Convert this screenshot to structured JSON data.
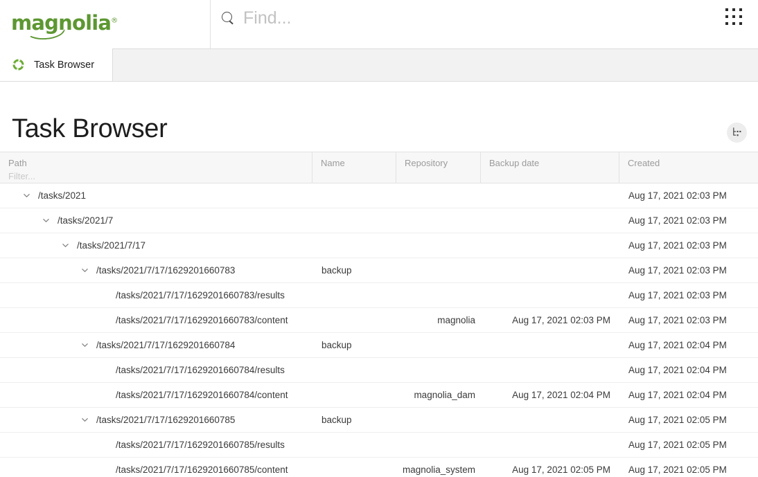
{
  "brand": {
    "logo_text": "magnolia",
    "logo_mark": "®",
    "logo_color": "#5d9732"
  },
  "header": {
    "search_placeholder": "Find...",
    "search_value": "",
    "search_icon": "search-icon",
    "launcher_icon": "apps-grid-icon"
  },
  "tabs": [
    {
      "label": "Task Browser",
      "icon": "recycle-icon",
      "active": true
    }
  ],
  "page": {
    "title": "Task Browser",
    "tree_toggle_icon": "tree-hierarchy-icon"
  },
  "table": {
    "columns": [
      {
        "key": "path",
        "label": "Path",
        "filter_placeholder": "Filter...",
        "has_filter": true
      },
      {
        "key": "name",
        "label": "Name",
        "has_filter": false
      },
      {
        "key": "repository",
        "label": "Repository",
        "has_filter": false
      },
      {
        "key": "backup_date",
        "label": "Backup date",
        "has_filter": false
      },
      {
        "key": "created",
        "label": "Created",
        "has_filter": false
      }
    ],
    "rows": [
      {
        "level": 0,
        "expandable": true,
        "expanded": true,
        "path": "/tasks/2021",
        "name": "",
        "repository": "",
        "backup_date": "",
        "created": "Aug 17, 2021 02:03 PM"
      },
      {
        "level": 1,
        "expandable": true,
        "expanded": true,
        "path": "/tasks/2021/7",
        "name": "",
        "repository": "",
        "backup_date": "",
        "created": "Aug 17, 2021 02:03 PM"
      },
      {
        "level": 2,
        "expandable": true,
        "expanded": true,
        "path": "/tasks/2021/7/17",
        "name": "",
        "repository": "",
        "backup_date": "",
        "created": "Aug 17, 2021 02:03 PM"
      },
      {
        "level": 3,
        "expandable": true,
        "expanded": true,
        "path": "/tasks/2021/7/17/1629201660783",
        "name": "backup",
        "repository": "",
        "backup_date": "",
        "created": "Aug 17, 2021 02:03 PM"
      },
      {
        "level": 4,
        "expandable": false,
        "expanded": false,
        "path": "/tasks/2021/7/17/1629201660783/results",
        "name": "",
        "repository": "",
        "backup_date": "",
        "created": "Aug 17, 2021 02:03 PM"
      },
      {
        "level": 4,
        "expandable": false,
        "expanded": false,
        "path": "/tasks/2021/7/17/1629201660783/content",
        "name": "",
        "repository": "magnolia",
        "backup_date": "Aug 17, 2021 02:03 PM",
        "created": "Aug 17, 2021 02:03 PM"
      },
      {
        "level": 3,
        "expandable": true,
        "expanded": true,
        "path": "/tasks/2021/7/17/1629201660784",
        "name": "backup",
        "repository": "",
        "backup_date": "",
        "created": "Aug 17, 2021 02:04 PM"
      },
      {
        "level": 4,
        "expandable": false,
        "expanded": false,
        "path": "/tasks/2021/7/17/1629201660784/results",
        "name": "",
        "repository": "",
        "backup_date": "",
        "created": "Aug 17, 2021 02:04 PM"
      },
      {
        "level": 4,
        "expandable": false,
        "expanded": false,
        "path": "/tasks/2021/7/17/1629201660784/content",
        "name": "",
        "repository": "magnolia_dam",
        "backup_date": "Aug 17, 2021 02:04 PM",
        "created": "Aug 17, 2021 02:04 PM"
      },
      {
        "level": 3,
        "expandable": true,
        "expanded": true,
        "path": "/tasks/2021/7/17/1629201660785",
        "name": "backup",
        "repository": "",
        "backup_date": "",
        "created": "Aug 17, 2021 02:05 PM"
      },
      {
        "level": 4,
        "expandable": false,
        "expanded": false,
        "path": "/tasks/2021/7/17/1629201660785/results",
        "name": "",
        "repository": "",
        "backup_date": "",
        "created": "Aug 17, 2021 02:05 PM"
      },
      {
        "level": 4,
        "expandable": false,
        "expanded": false,
        "path": "/tasks/2021/7/17/1629201660785/content",
        "name": "",
        "repository": "magnolia_system",
        "backup_date": "Aug 17, 2021 02:05 PM",
        "created": "Aug 17, 2021 02:05 PM"
      }
    ]
  }
}
